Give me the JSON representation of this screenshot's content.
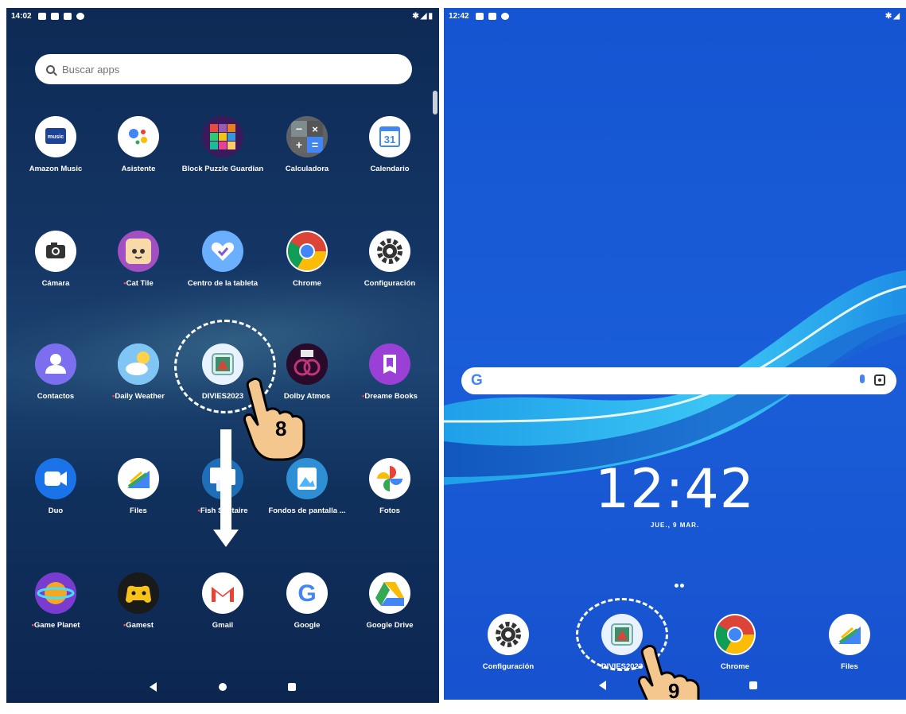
{
  "left_screen": {
    "status": {
      "time": "14:02"
    },
    "search": {
      "placeholder": "Buscar apps"
    },
    "apps": [
      {
        "label": "Amazon Music",
        "icon": "amazon-music-icon",
        "new": false
      },
      {
        "label": "Asistente",
        "icon": "assistant-icon",
        "new": false
      },
      {
        "label": "Block Puzzle Guardian",
        "icon": "block-puzzle-icon",
        "new": false
      },
      {
        "label": "Calculadora",
        "icon": "calculator-icon",
        "new": false
      },
      {
        "label": "Calendario",
        "icon": "calendar-icon",
        "new": false,
        "glyph": "31"
      },
      {
        "label": "Cámara",
        "icon": "camera-icon",
        "new": false
      },
      {
        "label": "Cat Tile",
        "icon": "cat-tile-icon",
        "new": true
      },
      {
        "label": "Centro de la tableta",
        "icon": "tablet-center-icon",
        "new": false
      },
      {
        "label": "Chrome",
        "icon": "chrome-icon",
        "new": false
      },
      {
        "label": "Configuración",
        "icon": "settings-icon",
        "new": false
      },
      {
        "label": "Contactos",
        "icon": "contacts-icon",
        "new": false
      },
      {
        "label": "Daily Weather",
        "icon": "weather-icon",
        "new": true
      },
      {
        "label": "DIVIES2023",
        "icon": "divies-icon",
        "new": false
      },
      {
        "label": "Dolby Atmos",
        "display": "Dolby Atmos",
        "icon": "dolby-icon",
        "new": false
      },
      {
        "label": "Dreame Books",
        "icon": "dreame-books-icon",
        "new": true
      },
      {
        "label": "Duo",
        "icon": "duo-icon",
        "new": false
      },
      {
        "label": "Files",
        "icon": "files-icon",
        "new": false
      },
      {
        "label": "Fish Solitaire",
        "display": "Fish Solitaire",
        "icon": "fish-solitaire-icon",
        "new": true
      },
      {
        "label": "Fondos de pantalla ...",
        "icon": "wallpapers-icon",
        "new": false
      },
      {
        "label": "Fotos",
        "icon": "photos-icon",
        "new": false
      },
      {
        "label": "Game Planet",
        "icon": "game-planet-icon",
        "new": true
      },
      {
        "label": "Gamest",
        "icon": "gamest-icon",
        "new": true
      },
      {
        "label": "Gmail",
        "icon": "gmail-icon",
        "new": false
      },
      {
        "label": "Google",
        "icon": "google-icon",
        "new": false
      },
      {
        "label": "Google Drive",
        "icon": "google-drive-icon",
        "new": false
      }
    ],
    "step_number": "8"
  },
  "right_screen": {
    "status": {
      "time": "12:42"
    },
    "clock": "12:42",
    "date": "JUE., 9 MAR.",
    "search_logo": "G",
    "dock": [
      {
        "label": "Configuración",
        "icon": "settings-icon"
      },
      {
        "label": "DIVIES2023",
        "icon": "divies-icon"
      },
      {
        "label": "Chrome",
        "icon": "chrome-icon"
      },
      {
        "label": "Files",
        "icon": "files-icon"
      }
    ],
    "step_number": "9"
  },
  "colors": {
    "drawer_bg": "#0f2d5a",
    "home_bg": "#1a5bd6",
    "new_dot": "#ff4a4a"
  }
}
